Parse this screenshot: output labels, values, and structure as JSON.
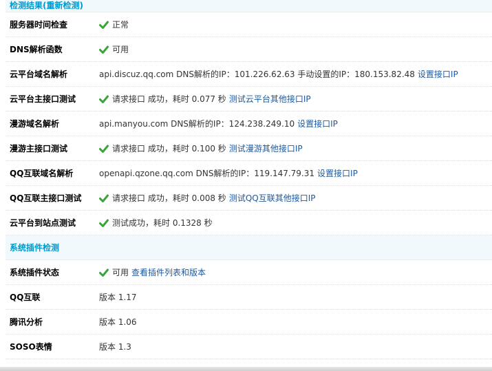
{
  "sections": {
    "check_result_title": "检测结果(重新检测)",
    "plugin_title": "系统插件检测"
  },
  "rows": {
    "server_time": {
      "label": "服务器时间检查",
      "value": "正常"
    },
    "dns_func": {
      "label": "DNS解析函数",
      "value": "可用"
    },
    "cloud_domain": {
      "label": "云平台域名解析",
      "value": "api.discuz.qq.com DNS解析的IP：101.226.62.63 手动设置的IP：180.153.82.48",
      "link": "设置接口IP"
    },
    "cloud_main": {
      "label": "云平台主接口测试",
      "value": "请求接口 成功，耗时 0.077 秒",
      "link": "测试云平台其他接口IP"
    },
    "manyou_domain": {
      "label": "漫游域名解析",
      "value": "api.manyou.com DNS解析的IP：124.238.249.10",
      "link": "设置接口IP"
    },
    "manyou_main": {
      "label": "漫游主接口测试",
      "value": "请求接口 成功，耗时 0.100 秒",
      "link": "测试漫游其他接口IP"
    },
    "qq_domain": {
      "label": "QQ互联域名解析",
      "value": "openapi.qzone.qq.com DNS解析的IP：119.147.79.31",
      "link": "设置接口IP"
    },
    "qq_main": {
      "label": "QQ互联主接口测试",
      "value": "请求接口 成功，耗时 0.008 秒",
      "link": "测试QQ互联其他接口IP"
    },
    "cloud_site": {
      "label": "云平台到站点测试",
      "value": "测试成功，耗时 0.1328 秒"
    },
    "plugin_status": {
      "label": "系统插件状态",
      "value": "可用",
      "link": "查看插件列表和版本"
    },
    "qq_connect": {
      "label": "QQ互联",
      "value": "版本 1.17"
    },
    "tencent_analysis": {
      "label": "腾讯分析",
      "value": "版本 1.06"
    },
    "soso_emoji": {
      "label": "SOSO表情",
      "value": "版本 1.3"
    }
  },
  "colors": {
    "section_title": "#0099cc",
    "section_bg": "#f2f9fd",
    "link": "#1c5aa0",
    "check": "#3aa33a"
  },
  "icons": {
    "ok": "check-mark-icon"
  }
}
